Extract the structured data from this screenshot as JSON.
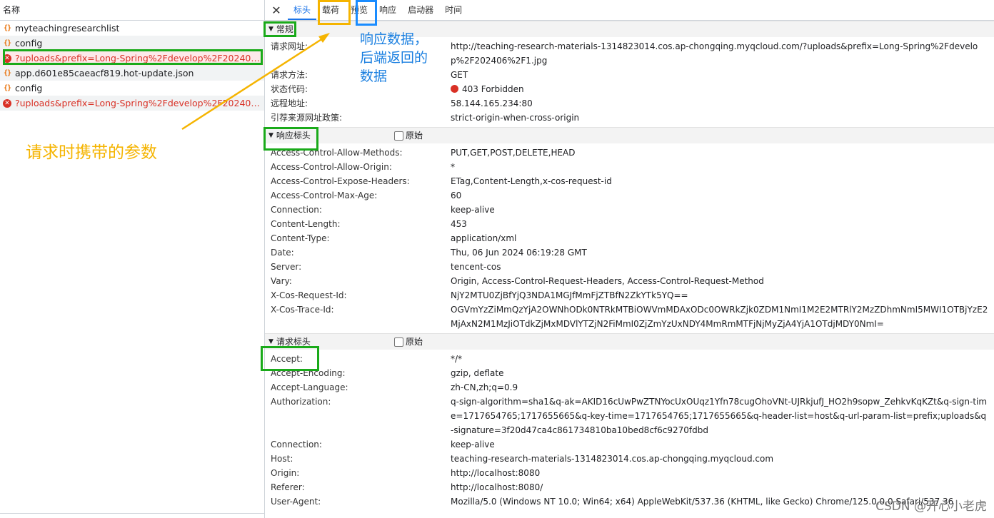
{
  "left_panel": {
    "header": "名称",
    "requests": [
      {
        "name": "myteachingresearchlist",
        "type": "json",
        "error": false
      },
      {
        "name": "config",
        "type": "json",
        "error": false
      },
      {
        "name": "?uploads&prefix=Long-Spring%2Fdevelop%2F202406%2...",
        "type": "error",
        "error": true
      },
      {
        "name": "app.d601e85caeacf819.hot-update.json",
        "type": "json",
        "error": false
      },
      {
        "name": "config",
        "type": "json",
        "error": false
      },
      {
        "name": "?uploads&prefix=Long-Spring%2Fdevelop%2F202406%2...",
        "type": "error",
        "error": true
      }
    ]
  },
  "tabs": [
    "标头",
    "载荷",
    "预览",
    "响应",
    "启动器",
    "时间"
  ],
  "active_tab": "标头",
  "general": {
    "title": "常规",
    "rows": [
      {
        "k": "请求网址:",
        "v": "http://teaching-research-materials-1314823014.cos.ap-chongqing.myqcloud.com/?uploads&prefix=Long-Spring%2Fdevelop%2F202406%2F1.jpg"
      },
      {
        "k": "请求方法:",
        "v": "GET"
      },
      {
        "k": "状态代码:",
        "v": "403 Forbidden"
      },
      {
        "k": "远程地址:",
        "v": "58.144.165.234:80"
      },
      {
        "k": "引荐来源网址政策:",
        "v": "strict-origin-when-cross-origin"
      }
    ]
  },
  "response_headers": {
    "title": "响应标头",
    "raw_label": "原始",
    "rows": [
      {
        "k": "Access-Control-Allow-Methods:",
        "v": "PUT,GET,POST,DELETE,HEAD"
      },
      {
        "k": "Access-Control-Allow-Origin:",
        "v": "*"
      },
      {
        "k": "Access-Control-Expose-Headers:",
        "v": "ETag,Content-Length,x-cos-request-id"
      },
      {
        "k": "Access-Control-Max-Age:",
        "v": "60"
      },
      {
        "k": "Connection:",
        "v": "keep-alive"
      },
      {
        "k": "Content-Length:",
        "v": "453"
      },
      {
        "k": "Content-Type:",
        "v": "application/xml"
      },
      {
        "k": "Date:",
        "v": "Thu, 06 Jun 2024 06:19:28 GMT"
      },
      {
        "k": "Server:",
        "v": "tencent-cos"
      },
      {
        "k": "Vary:",
        "v": "Origin, Access-Control-Request-Headers, Access-Control-Request-Method"
      },
      {
        "k": "X-Cos-Request-Id:",
        "v": "NjY2MTU0ZjBfYjQ3NDA1MGJfMmFjZTBfN2ZkYTk5YQ=="
      },
      {
        "k": "X-Cos-Trace-Id:",
        "v": "OGVmYzZiMmQzYjA2OWNhODk0NTRkMTBiOWVmMDAxODc0OWRkZjk0ZDM1NmI1M2E2MTRlY2MzZDhmNmI5MWI1OTBjYzE2MjAxN2M1MzJiOTdkZjMxMDVlYTZjN2FiMmI0ZjZmYzUxNDY4MmRmMTFjNjMyZjA4YjA1OTdjMDY0NmI="
      }
    ]
  },
  "request_headers": {
    "title": "请求标头",
    "raw_label": "原始",
    "rows": [
      {
        "k": "Accept:",
        "v": "*/*"
      },
      {
        "k": "Accept-Encoding:",
        "v": "gzip, deflate"
      },
      {
        "k": "Accept-Language:",
        "v": "zh-CN,zh;q=0.9"
      },
      {
        "k": "Authorization:",
        "v": "q-sign-algorithm=sha1&q-ak=AKID16cUwPwZTNYocUxOUqz1Yfn78cugOhoVNt-UJRkjufJ_HO2h9sopw_ZehkvKqKZt&q-sign-time=1717654765;1717655665&q-key-time=1717654765;1717655665&q-header-list=host&q-url-param-list=prefix;uploads&q-signature=3f20d47ca4c861734810ba10bed8cf6c9270fdbd"
      },
      {
        "k": "Connection:",
        "v": "keep-alive"
      },
      {
        "k": "Host:",
        "v": "teaching-research-materials-1314823014.cos.ap-chongqing.myqcloud.com"
      },
      {
        "k": "Origin:",
        "v": "http://localhost:8080"
      },
      {
        "k": "Referer:",
        "v": "http://localhost:8080/"
      },
      {
        "k": "User-Agent:",
        "v": "Mozilla/5.0 (Windows NT 10.0; Win64; x64) AppleWebKit/537.36 (KHTML, like Gecko) Chrome/125.0.0.0 Safari/537.36"
      }
    ]
  },
  "annotations": {
    "left_note": "请求时携带的参数",
    "right_note": "响应数据，后端返回的数据"
  },
  "watermark": "CSDN @开心小老虎",
  "colors": {
    "green": "#1aaa1a",
    "orange": "#f5b400",
    "blue": "#1a8cff",
    "error": "#d93025",
    "accent": "#1a73e8"
  }
}
